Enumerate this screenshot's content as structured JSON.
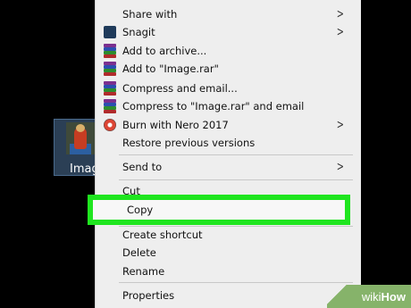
{
  "desktop": {
    "file_label": "Image"
  },
  "menu": {
    "items": [
      {
        "label": "Share with",
        "submenu": true
      },
      {
        "label": "Snagit",
        "submenu": true
      },
      {
        "label": "Add to archive..."
      },
      {
        "label": "Add to \"Image.rar\""
      },
      {
        "label": "Compress and email..."
      },
      {
        "label": "Compress to \"Image.rar\" and email"
      },
      {
        "label": "Burn with Nero 2017",
        "submenu": true
      },
      {
        "label": "Restore previous versions"
      },
      {
        "label": "Send to",
        "submenu": true
      },
      {
        "label": "Cut"
      },
      {
        "label": "Copy",
        "highlighted": true
      },
      {
        "label": "Create shortcut"
      },
      {
        "label": "Delete"
      },
      {
        "label": "Rename"
      },
      {
        "label": "Properties"
      }
    ],
    "submenu_glyph": ">"
  },
  "highlight_color": "#1fe51f",
  "watermark": {
    "part1": "wiki",
    "part2": "How"
  }
}
